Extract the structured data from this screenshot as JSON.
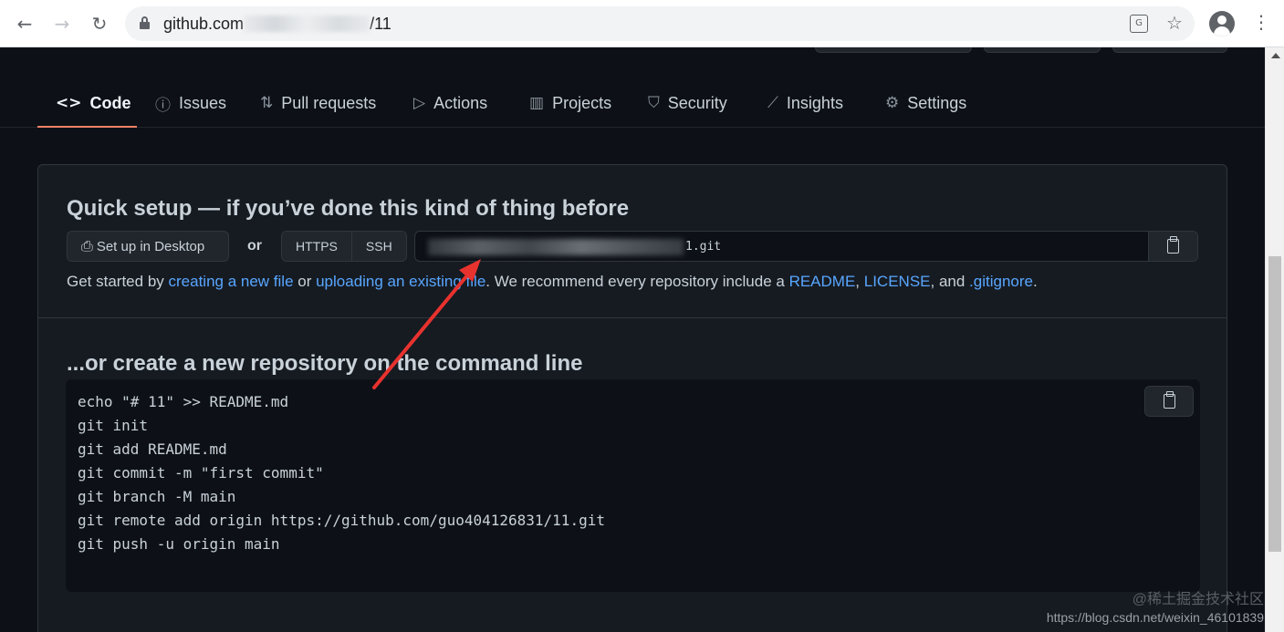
{
  "browser": {
    "url_prefix": "github.com",
    "url_suffix": "/11"
  },
  "repo_nav": {
    "tabs": [
      {
        "label": "Code",
        "icon": "code-icon",
        "active": true
      },
      {
        "label": "Issues",
        "icon": "issue-icon"
      },
      {
        "label": "Pull requests",
        "icon": "pull-request-icon"
      },
      {
        "label": "Actions",
        "icon": "play-icon"
      },
      {
        "label": "Projects",
        "icon": "project-icon"
      },
      {
        "label": "Security",
        "icon": "shield-icon"
      },
      {
        "label": "Insights",
        "icon": "graph-icon"
      },
      {
        "label": "Settings",
        "icon": "gear-icon"
      }
    ]
  },
  "quick_setup": {
    "title": "Quick setup — if you’ve done this kind of thing before",
    "desktop_button": "Set up in Desktop",
    "or_label": "or",
    "https_label": "HTTPS",
    "ssh_label": "SSH",
    "clone_url_visible": "1.git",
    "getstarted": {
      "t1": "Get started by ",
      "link_new_file": "creating a new file",
      "t2": " or ",
      "link_upload": "uploading an existing file",
      "t3": ". We recommend every repository include a ",
      "link_readme": "README",
      "t4": ", ",
      "link_license": "LICENSE",
      "t5": ", and ",
      "link_gitignore": ".gitignore",
      "t6": "."
    }
  },
  "command_line": {
    "title": "...or create a new repository on the command line",
    "lines": [
      "echo \"# 11\" >> README.md",
      "git init",
      "git add README.md",
      "git commit -m \"first commit\"",
      "git branch -M main",
      "git remote add origin https://github.com/guo404126831/11.git",
      "git push -u origin main"
    ]
  },
  "watermark": {
    "cn": "@稀土掘金技术社区",
    "url": "https://blog.csdn.net/weixin_46101839"
  },
  "colors": {
    "accent_underline": "#f78166",
    "link": "#58a6ff",
    "annotation_arrow": "#e8322e"
  }
}
